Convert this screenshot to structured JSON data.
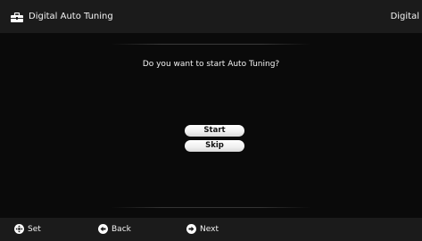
{
  "header": {
    "title": "Digital Auto Tuning",
    "right_label": "Digital",
    "icon": "toolbox-icon"
  },
  "dialog": {
    "question": "Do you want to start Auto Tuning?",
    "buttons": {
      "start_label": "Start",
      "skip_label": "Skip"
    }
  },
  "footer": {
    "set": {
      "label": "Set",
      "icon": "dpad-center-icon"
    },
    "back": {
      "label": "Back",
      "icon": "back-arrow-icon"
    },
    "next": {
      "label": "Next",
      "icon": "next-arrow-icon"
    }
  },
  "colors": {
    "background": "#0b0b0b",
    "bar": "#1b1b1b",
    "text": "#f2f2f2",
    "button": "#ffffff"
  }
}
